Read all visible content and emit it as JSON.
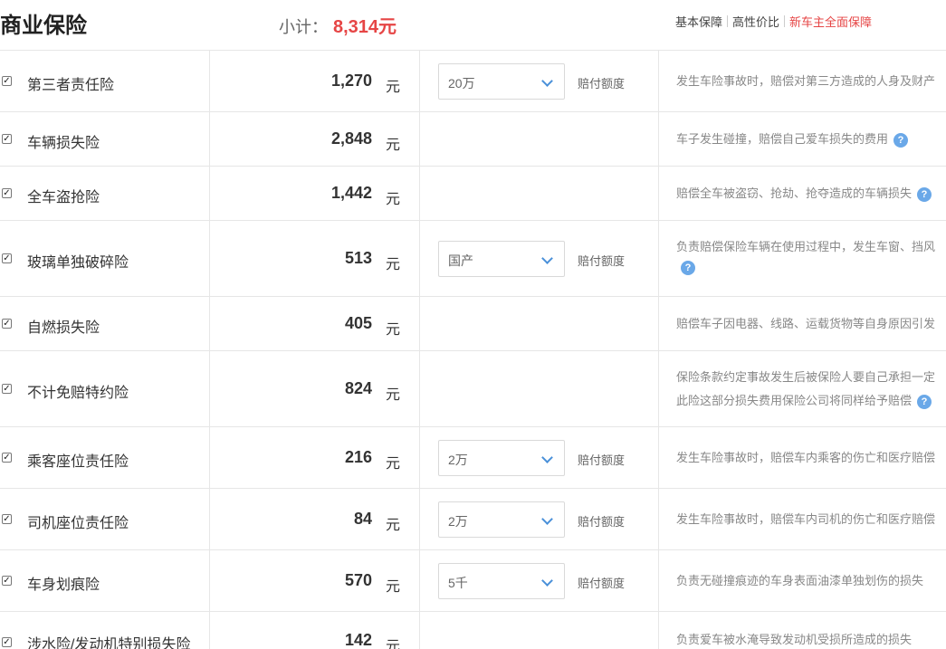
{
  "header": {
    "title": "商业保险",
    "subtotal_label": "小计：",
    "subtotal_value": "8,314元",
    "links": [
      "基本保障",
      "高性价比",
      "新车主全面保障"
    ]
  },
  "labels": {
    "unit": "元",
    "coverage": "赔付额度",
    "help": "?"
  },
  "rows": [
    {
      "name": "第三者责任险",
      "price": "1,270",
      "select": "20万",
      "desc": [
        "发生车险事故时，赔偿对第三方造成的人身及财产"
      ]
    },
    {
      "name": "车辆损失险",
      "price": "2,848",
      "select": null,
      "desc": [
        "车子发生碰撞，赔偿自己爱车损失的费用"
      ]
    },
    {
      "name": "全车盗抢险",
      "price": "1,442",
      "select": null,
      "desc": [
        "赔偿全车被盗窃、抢劫、抢夺造成的车辆损失"
      ]
    },
    {
      "name": "玻璃单独破碎险",
      "price": "513",
      "select": "国产",
      "desc": [
        "负责赔偿保险车辆在使用过程中，发生车窗、挡风"
      ]
    },
    {
      "name": "自燃损失险",
      "price": "405",
      "select": null,
      "desc": [
        "赔偿车子因电器、线路、运载货物等自身原因引发"
      ]
    },
    {
      "name": "不计免赔特约险",
      "price": "824",
      "select": null,
      "desc": [
        "保险条款约定事故发生后被保险人要自己承担一定",
        "此险这部分损失费用保险公司将同样给予赔偿"
      ]
    },
    {
      "name": "乘客座位责任险",
      "price": "216",
      "select": "2万",
      "desc": [
        "发生车险事故时，赔偿车内乘客的伤亡和医疗赔偿"
      ]
    },
    {
      "name": "司机座位责任险",
      "price": "84",
      "select": "2万",
      "desc": [
        "发生车险事故时，赔偿车内司机的伤亡和医疗赔偿"
      ]
    },
    {
      "name": "车身划痕险",
      "price": "570",
      "select": "5千",
      "desc": [
        "负责无碰撞痕迹的车身表面油漆单独划伤的损失"
      ]
    },
    {
      "name": "涉水险/发动机特别损失险",
      "price": "142",
      "select": null,
      "desc": [
        "负责爱车被水淹导致发动机受损所造成的损失"
      ]
    }
  ]
}
